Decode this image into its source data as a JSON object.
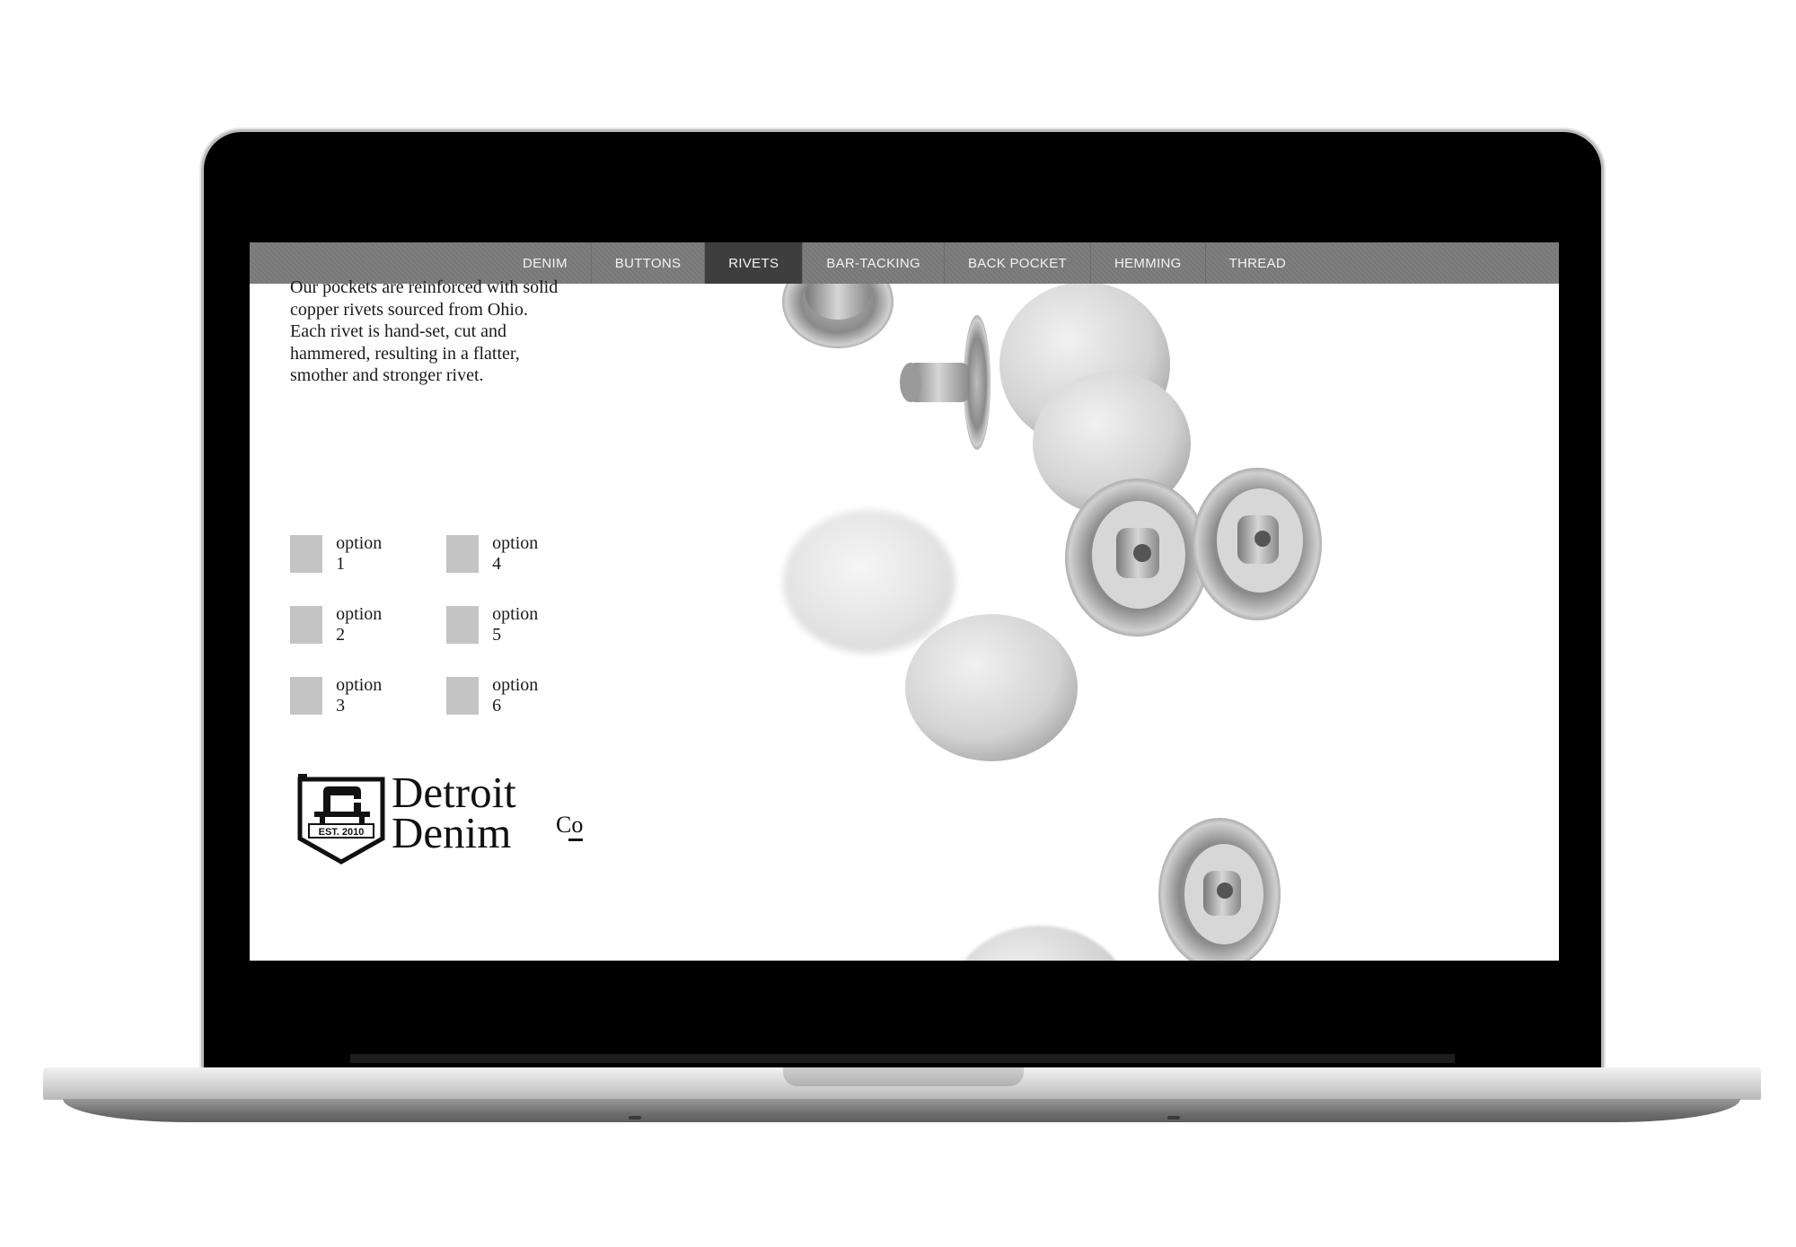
{
  "nav": {
    "items": [
      {
        "label": "DENIM"
      },
      {
        "label": "BUTTONS"
      },
      {
        "label": "RIVETS"
      },
      {
        "label": "BAR-TACKING"
      },
      {
        "label": "BACK POCKET"
      },
      {
        "label": "HEMMING"
      },
      {
        "label": "THREAD"
      }
    ],
    "active": "RIVETS"
  },
  "intro": {
    "lines": [
      "Our pockets are reinforced with solid",
      "copper rivets sourced from Ohio.",
      "Each rivet is hand-set, cut and",
      "hammered, resulting in a flatter,",
      "smother and stronger rivet."
    ]
  },
  "options": [
    {
      "label": "option 1"
    },
    {
      "label": "option 2"
    },
    {
      "label": "option 3"
    },
    {
      "label": "option 4"
    },
    {
      "label": "option 5"
    },
    {
      "label": "option 6"
    }
  ],
  "logo": {
    "line1": "Detroit",
    "line2": "Denim",
    "co": "Co",
    "badge": "EST. 2010"
  },
  "colors": {
    "nav_bg": "#7b7b7b",
    "nav_active": "#3e3e3e",
    "option_box": "#c4c4c4"
  }
}
